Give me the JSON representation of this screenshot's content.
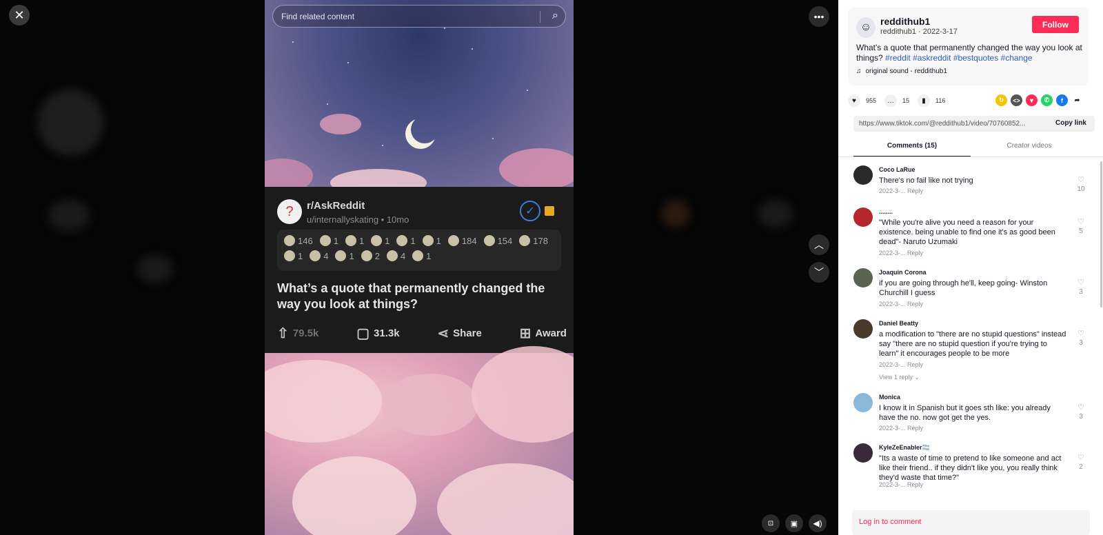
{
  "video": {
    "search_placeholder": "Find related content",
    "subreddit": "r/AskReddit",
    "post_meta": "u/internallyskating • 10mo",
    "awards": [
      {
        "icon": "award-icon",
        "count": "146"
      },
      {
        "icon": "award-icon",
        "count": "1"
      },
      {
        "icon": "award-icon",
        "count": "1"
      },
      {
        "icon": "award-icon",
        "count": "1"
      },
      {
        "icon": "award-icon",
        "count": "1"
      },
      {
        "icon": "award-icon",
        "count": "1"
      },
      {
        "icon": "award-icon",
        "count": "184"
      },
      {
        "icon": "award-icon",
        "count": "154"
      },
      {
        "icon": "award-icon",
        "count": "178"
      },
      {
        "icon": "award-icon",
        "count": "1"
      },
      {
        "icon": "award-icon",
        "count": "4"
      },
      {
        "icon": "award-icon",
        "count": "1"
      },
      {
        "icon": "award-icon",
        "count": "2"
      },
      {
        "icon": "award-icon",
        "count": "4"
      },
      {
        "icon": "award-icon",
        "count": "1"
      }
    ],
    "post_title": "What’s a quote that permanently changed the way you look at things?",
    "upvotes": "79.5k",
    "comments": "31.3k",
    "share_label": "Share",
    "award_label": "Award"
  },
  "author": {
    "name": "reddithub1",
    "handle_date": "reddithub1 · 2022-3-17",
    "follow_label": "Follow",
    "desc_text": "What's a quote that permanently changed the way you look at things?",
    "tags": [
      "#reddit",
      "#askreddit",
      "#bestquotes",
      "#change"
    ],
    "sound": "original sound - reddithub1"
  },
  "stats": {
    "likes": "955",
    "comments": "15",
    "saves": "116"
  },
  "share_colors": [
    "#f5c400",
    "#555555",
    "#fe2c55",
    "#25d366",
    "#1877f2"
  ],
  "link": {
    "url": "https://www.tiktok.com/@reddithub1/video/70760852...",
    "copy_label": "Copy link"
  },
  "tabs": [
    {
      "label": "Comments (15)",
      "active": true
    },
    {
      "label": "Creator videos",
      "active": false
    }
  ],
  "comments": [
    {
      "name": "Coco LaRue",
      "text": "There's no fail like not trying",
      "meta": "2022-3-... Reply",
      "likes": "10",
      "avatar_color": "#2a2a2a",
      "replies": ""
    },
    {
      "name": "........",
      "text": "\"While you're alive you need a reason for your existence. being unable to find one it's as good been dead\"- Naruto Uzumaki",
      "meta": "2022-3-... Reply",
      "likes": "5",
      "avatar_color": "#b8262e",
      "replies": ""
    },
    {
      "name": "Joaquin Corona",
      "text": "if you are going through he'll, keep going- Winston Churchill I guess",
      "meta": "2022-3-... Reply",
      "likes": "3",
      "avatar_color": "#5a6450",
      "replies": ""
    },
    {
      "name": "Daniel Beatty",
      "text": "a modification to \"there are no stupid questions\" instead say \"there are no stupid question if you're trying to learn\" it encourages people to be more",
      "meta": "2022-3-... Reply",
      "likes": "3",
      "avatar_color": "#4a3a2a",
      "replies": "View 1 reply"
    },
    {
      "name": "Monica",
      "text": "I know it in Spanish but it goes sth like: you already have the no. now got get the yes.",
      "meta": "2022-3-... Reply",
      "likes": "3",
      "avatar_color": "#8ab8d8",
      "replies": ""
    },
    {
      "name": "KyleZeEnabler🏳️‍⚧️",
      "text": "\"Its a waste of time to pretend to like someone and act like their friend.. if they didn't like you, you really think they'd waste that time?\"",
      "meta": "2022-3-... Reply",
      "likes": "2",
      "avatar_color": "#3a2a3a",
      "replies": ""
    }
  ],
  "login_label": "Log in to comment"
}
